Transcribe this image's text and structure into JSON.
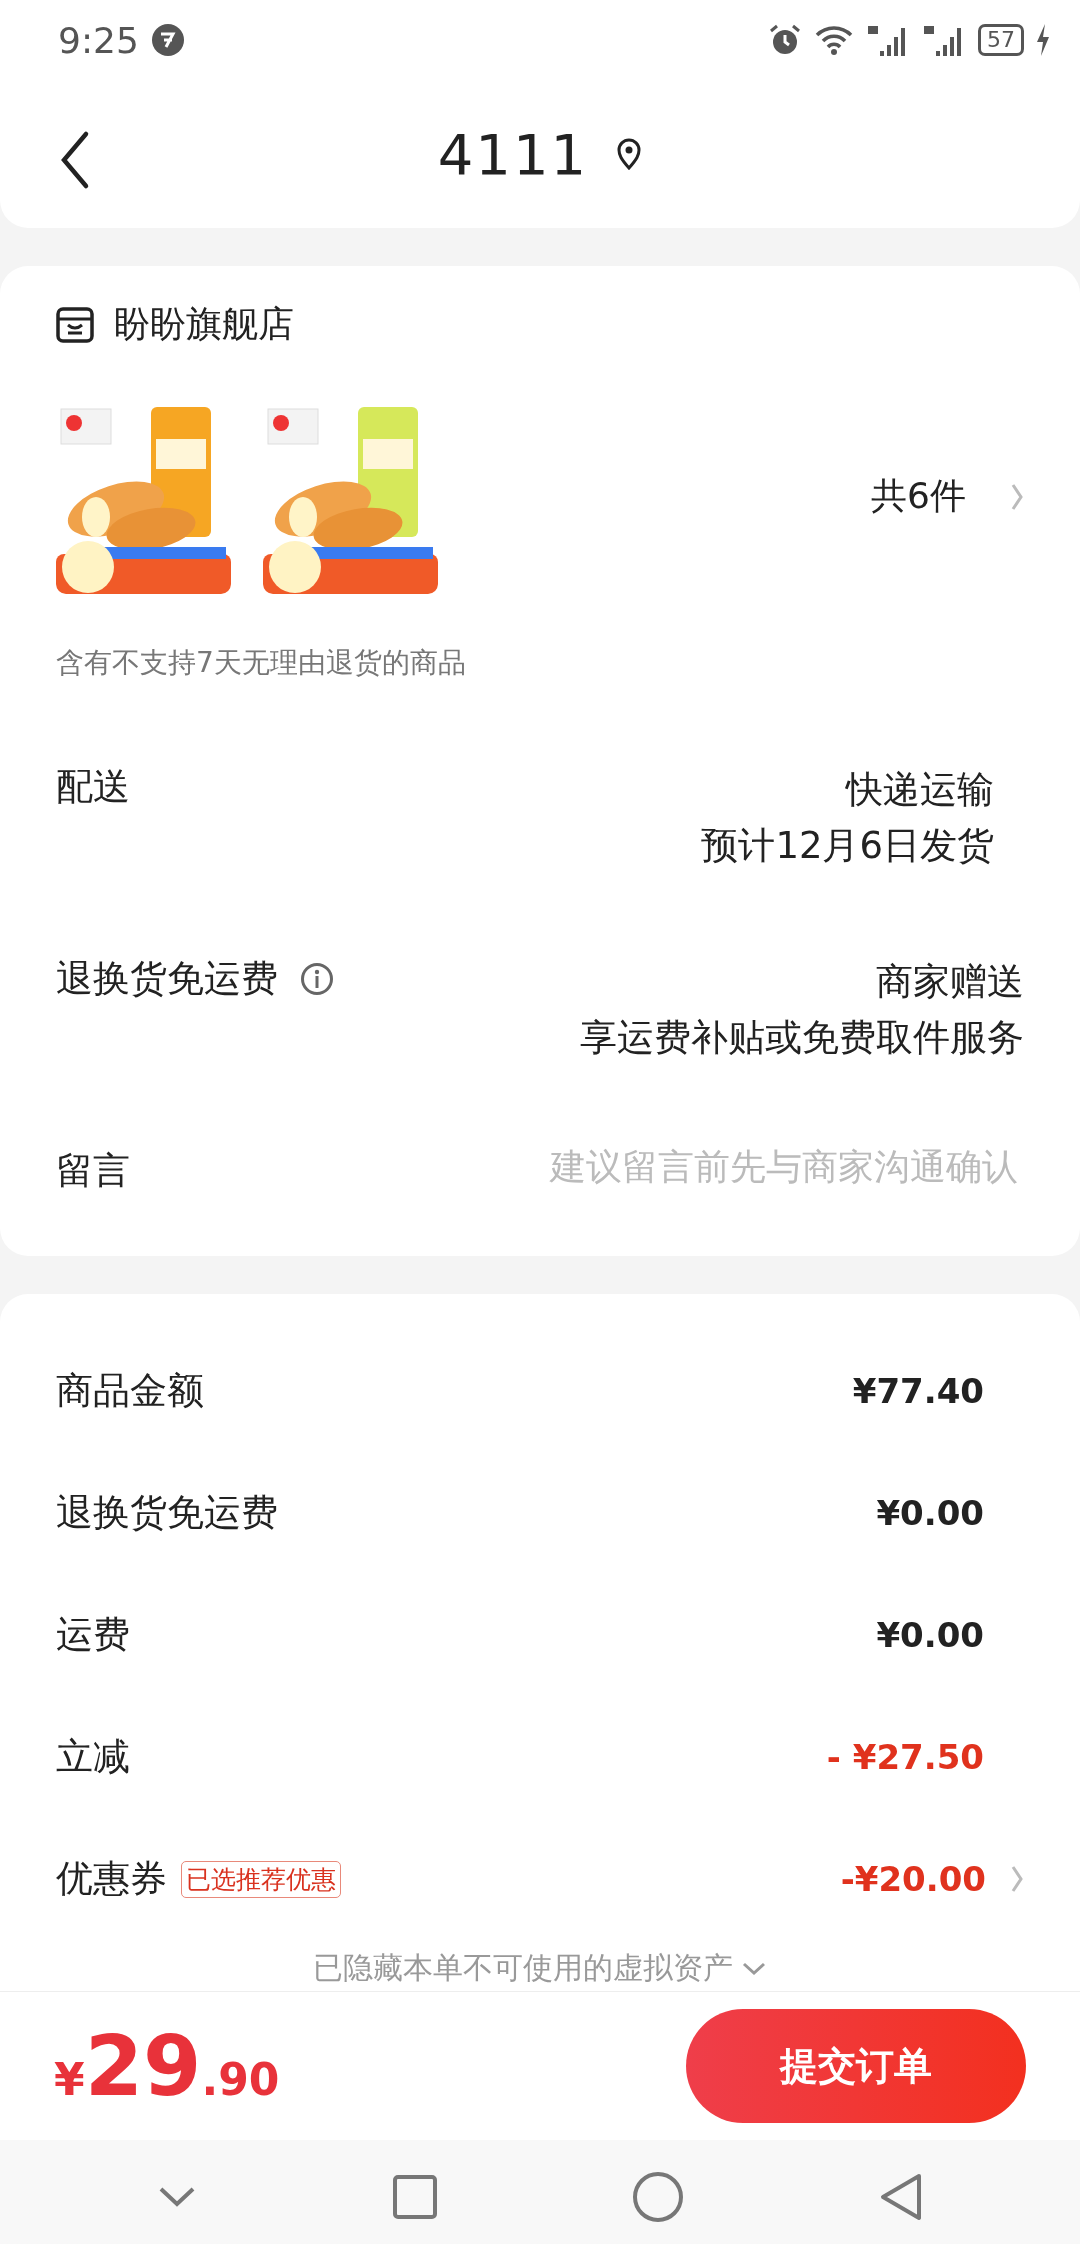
{
  "status_bar": {
    "time": "9:25",
    "battery": "57"
  },
  "header": {
    "title": "4111"
  },
  "store": {
    "name": "盼盼旗舰店",
    "count": "共6件",
    "notice": "含有不支持7天无理由退货的商品"
  },
  "details": [
    {
      "kind": "text",
      "label": "配送",
      "lines": [
        "快递运输",
        "预计12月6日发货"
      ]
    },
    {
      "kind": "info",
      "label": "退换货免运费",
      "lines": [
        "商家赠送",
        "享运费补贴或免费取件服务"
      ]
    },
    {
      "kind": "input",
      "label": "留言",
      "placeholder": "建议留言前先与商家沟通确认"
    }
  ],
  "summary": [
    {
      "label": "商品金额",
      "value": "¥77.40",
      "discount": false
    },
    {
      "label": "退换货免运费",
      "value": "¥0.00",
      "discount": false
    },
    {
      "label": "运费",
      "value": "¥0.00",
      "discount": false
    },
    {
      "label": "立减",
      "value": "- ¥27.50",
      "discount": true
    },
    {
      "label": "优惠券",
      "tag": "已选推荐优惠",
      "value": "-¥20.00",
      "discount": true,
      "link": true
    }
  ],
  "hidden_note": "已隐藏本单不可使用的虚拟资产",
  "footer": {
    "currency": "¥",
    "price_int": "29",
    "price_dec": ".90",
    "submit": "提交订单"
  }
}
